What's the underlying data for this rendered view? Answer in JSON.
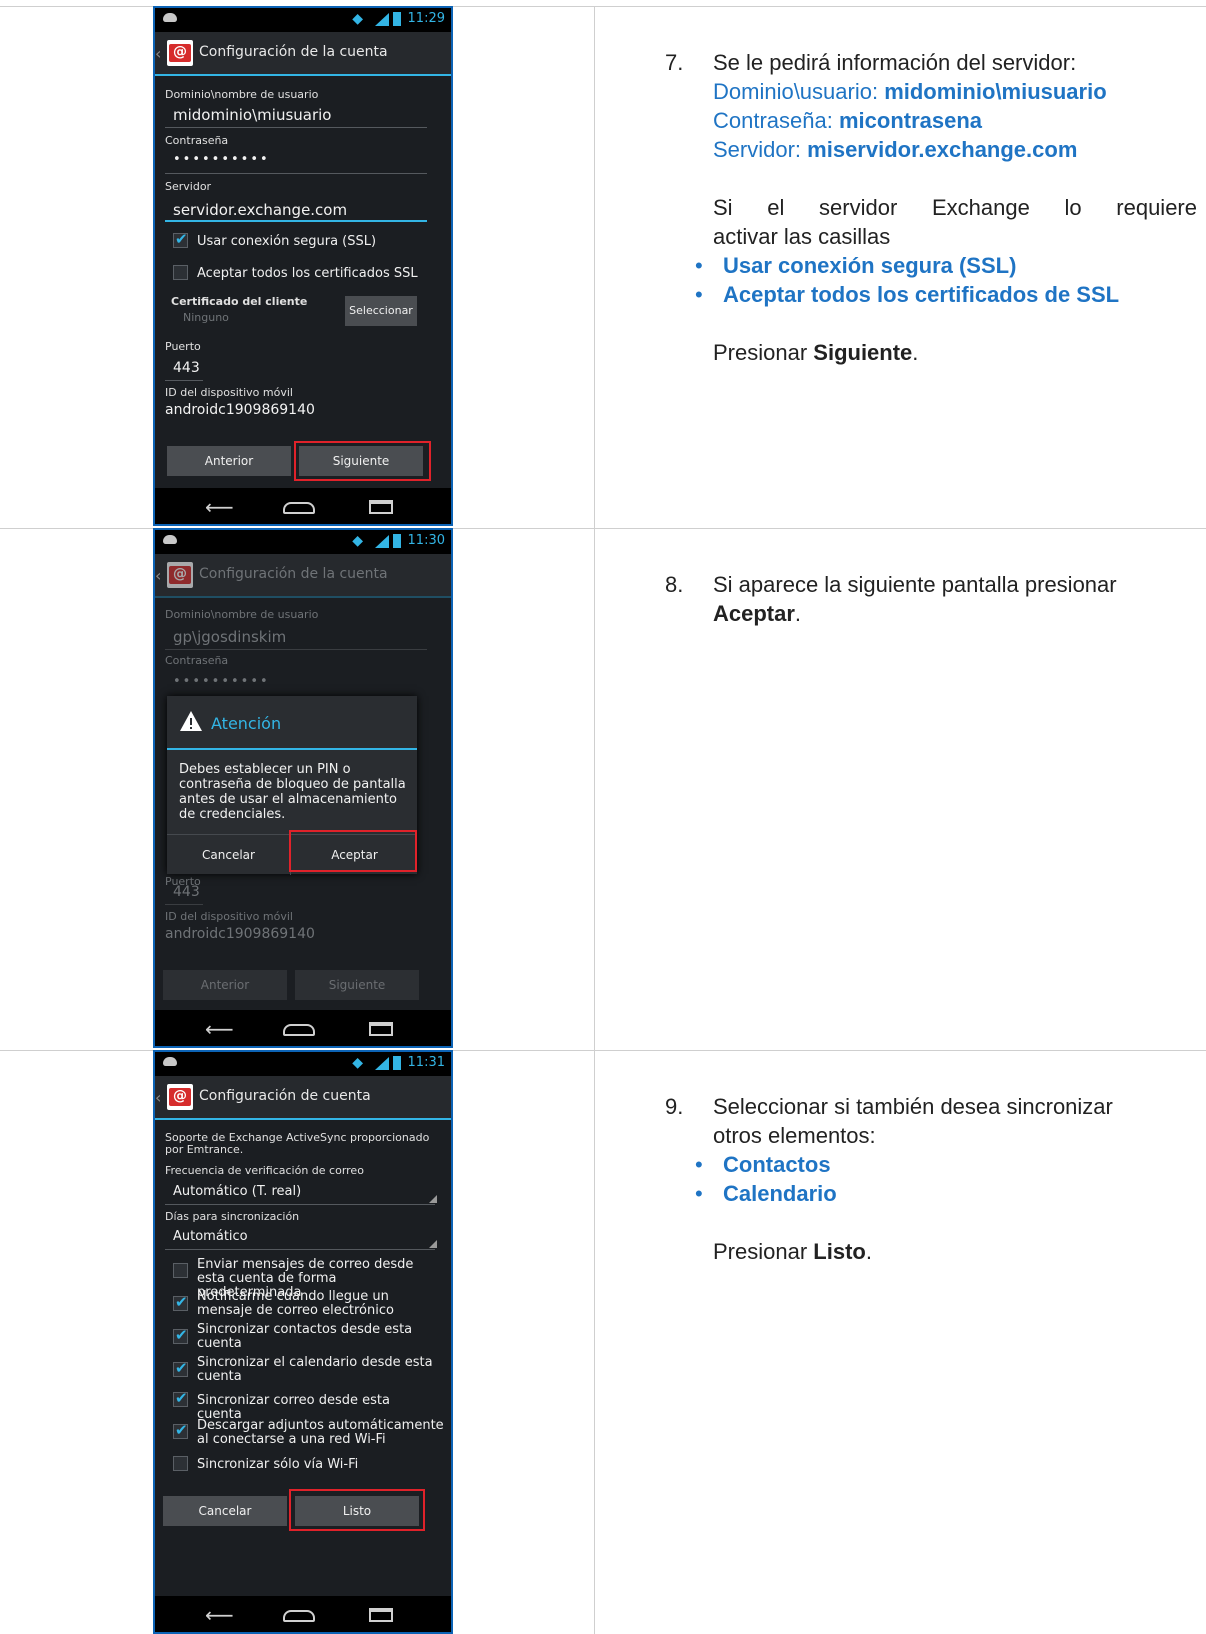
{
  "phone1": {
    "status_time": "11:29",
    "title": "Configuración de la cuenta",
    "domain_label": "Dominio\\nombre de usuario",
    "domain_value": "midominio\\miusuario",
    "password_label": "Contraseña",
    "password_value": "••••••••••",
    "server_label": "Servidor",
    "server_value": "servidor.exchange.com",
    "ssl_label": "Usar conexión segura (SSL)",
    "accept_certs_label": "Aceptar todos los certificados SSL",
    "client_cert_label": "Certificado del cliente",
    "client_cert_value": "Ninguno",
    "select_button": "Seleccionar",
    "port_label": "Puerto",
    "port_value": "443",
    "device_id_label": "ID del dispositivo móvil",
    "device_id_value": "androidc1909869140",
    "prev_button": "Anterior",
    "next_button": "Siguiente"
  },
  "phone2": {
    "status_time": "11:30",
    "title": "Configuración de la cuenta",
    "domain_label": "Dominio\\nombre de usuario",
    "domain_value": "gp\\jgosdinskim",
    "password_label": "Contraseña",
    "password_value": "••••••••••",
    "port_label": "Puerto",
    "port_value": "443",
    "device_id_label": "ID del dispositivo móvil",
    "device_id_value": "androidc1909869140",
    "prev_button": "Anterior",
    "next_button": "Siguiente",
    "dialog": {
      "title": "Atención",
      "message": "Debes establecer un PIN o contraseña de bloqueo de pantalla antes de usar el almacenamiento de credenciales.",
      "cancel": "Cancelar",
      "accept": "Aceptar"
    }
  },
  "phone3": {
    "status_time": "11:31",
    "title": "Configuración de cuenta",
    "support_text": "Soporte de Exchange ActiveSync proporcionado por Emtrance.",
    "freq_label": "Frecuencia de verificación de correo",
    "freq_value": "Automático (T. real)",
    "days_label": "Días para sincronización",
    "days_value": "Automático",
    "options": [
      {
        "label": "Enviar mensajes de correo desde esta cuenta de forma predeterminada",
        "checked": false
      },
      {
        "label": "Notificarme cuando llegue un mensaje de correo electrónico",
        "checked": true
      },
      {
        "label": "Sincronizar contactos desde esta cuenta",
        "checked": true
      },
      {
        "label": "Sincronizar el calendario desde esta cuenta",
        "checked": true
      },
      {
        "label": "Sincronizar correo desde esta cuenta",
        "checked": true
      },
      {
        "label": "Descargar adjuntos automáticamente al conectarse a una red Wi-Fi",
        "checked": true
      },
      {
        "label": "Sincronizar sólo vía Wi-Fi",
        "checked": false
      }
    ],
    "cancel_button": "Cancelar",
    "done_button": "Listo"
  },
  "step7": {
    "number": "7.",
    "intro": "Se le pedirá información del servidor:",
    "domain_prefix": "Dominio\\usuario: ",
    "domain_value": "midominio\\miusuario",
    "password_prefix": "Contraseña: ",
    "password_value": "micontrasena",
    "server_prefix": "Servidor: ",
    "server_value": "miservidor.exchange.com",
    "requirement_line1": "Si el servidor Exchange lo requiere",
    "requirement_line2": "activar las casillas",
    "bullet1": "Usar conexión segura (SSL)",
    "bullet2": "Aceptar todos los certificados de SSL",
    "press_prefix": "Presionar ",
    "press_bold": "Siguiente",
    "press_suffix": "."
  },
  "step8": {
    "number": "8.",
    "line1": "Si aparece la siguiente pantalla presionar",
    "press_bold": "Aceptar",
    "press_suffix": "."
  },
  "step9": {
    "number": "9.",
    "line1": "Seleccionar si también desea sincronizar",
    "line2": "otros elementos:",
    "bullet1": "Contactos",
    "bullet2": "Calendario",
    "press_prefix": "Presionar ",
    "press_bold": "Listo",
    "press_suffix": "."
  },
  "colors": {
    "accent_blue": "#1f74c4",
    "holo_blue": "#33b5e5",
    "highlight_red": "#e0222a"
  }
}
